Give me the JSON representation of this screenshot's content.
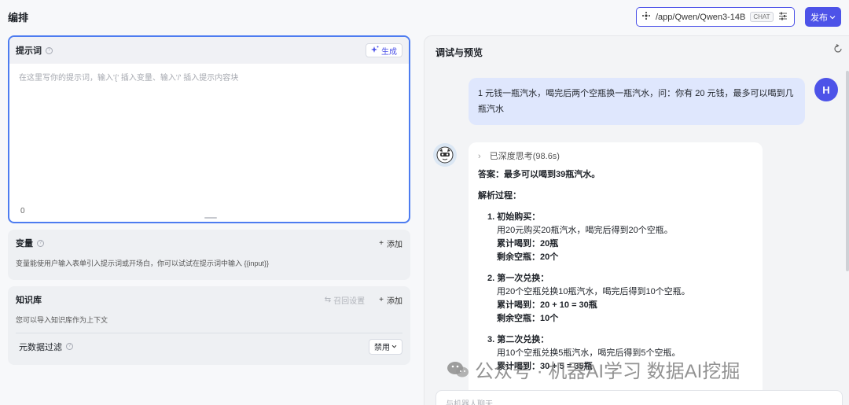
{
  "header": {
    "title": "编排",
    "app_path": "/app/Qwen/Qwen3-14B",
    "app_badge": "CHAT",
    "publish_label": "发布"
  },
  "prompt": {
    "title": "提示词",
    "generate_label": "生成",
    "placeholder": "在这里写你的提示词，输入'{' 插入变量、输入'/' 插入提示内容块",
    "char_count": "0"
  },
  "variables": {
    "title": "变量",
    "add_label": "添加",
    "description": "变量能使用户输入表单引入提示词或开场白，你可以试试在提示词中输入 {{input}}"
  },
  "knowledge": {
    "title": "知识库",
    "recall_label": "召回设置",
    "add_label": "添加",
    "description": "您可以导入知识库作为上下文",
    "metadata_filter_label": "元数据过滤",
    "metadata_filter_value": "禁用"
  },
  "preview": {
    "title": "调试与预览",
    "user_initial": "H",
    "user_message": "1 元钱一瓶汽水，喝完后两个空瓶换一瓶汽水，问：你有 20 元钱，最多可以喝到几瓶汽水",
    "thinking_label": "已深度思考(98.6s)",
    "answer": "答案：最多可以喝到39瓶汽水。",
    "analysis_heading": "解析过程：",
    "steps": [
      {
        "heading": "1. 初始购买：",
        "lines": [
          "用20元购买20瓶汽水，喝完后得到20个空瓶。",
          "累计喝到：20瓶",
          "剩余空瓶：20个"
        ]
      },
      {
        "heading": "2. 第一次兑换：",
        "lines": [
          "用20个空瓶兑换10瓶汽水，喝完后得到10个空瓶。",
          "累计喝到：20 + 10 = 30瓶",
          "剩余空瓶：10个"
        ]
      },
      {
        "heading": "3. 第二次兑换：",
        "lines": [
          "用10个空瓶兑换5瓶汽水，喝完后得到5个空瓶。",
          "累计喝到：30 + 5 = 35瓶"
        ]
      }
    ],
    "input_placeholder": "与机器人聊天"
  },
  "watermark": {
    "text": "公众号 · 机器AI学习 数据AI挖掘"
  },
  "colors": {
    "accent": "#4d53e8",
    "focus_border": "#4d7cf0",
    "user_bubble": "#dfe7fd"
  }
}
